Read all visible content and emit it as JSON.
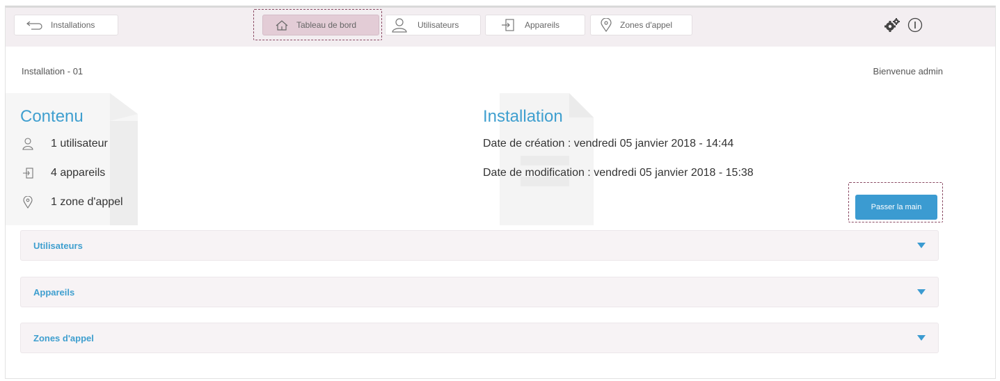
{
  "nav": {
    "back_label": "Installations",
    "tabs": [
      {
        "label": "Tableau de bord",
        "icon": "home-icon",
        "active": true
      },
      {
        "label": "Utilisateurs",
        "icon": "user-icon",
        "active": false
      },
      {
        "label": "Appareils",
        "icon": "device-icon",
        "active": false
      },
      {
        "label": "Zones d'appel",
        "icon": "location-pin-icon",
        "active": false
      }
    ],
    "settings_icon": "gears-icon",
    "info_icon": "info-icon"
  },
  "header": {
    "installation": "Installation - 01",
    "welcome": "Bienvenue admin"
  },
  "content": {
    "title": "Contenu",
    "items": [
      {
        "icon": "user-icon",
        "text": "1 utilisateur"
      },
      {
        "icon": "device-icon",
        "text": "4 appareils"
      },
      {
        "icon": "location-pin-icon",
        "text": "1 zone d'appel"
      }
    ]
  },
  "installation": {
    "title": "Installation",
    "created": "Date de création : vendredi 05 janvier 2018 - 14:44",
    "modified": "Date de modification : vendredi 05 janvier 2018 - 15:38",
    "handover_button": "Passer la main"
  },
  "accordions": [
    {
      "label": "Utilisateurs"
    },
    {
      "label": "Appareils"
    },
    {
      "label": "Zones d'appel"
    }
  ],
  "colors": {
    "accent": "#3f9fcf",
    "button": "#3b9bd1",
    "topbar": "#f3eef1",
    "active_tab": "#e3ccd6",
    "highlight": "#8a4a63"
  }
}
